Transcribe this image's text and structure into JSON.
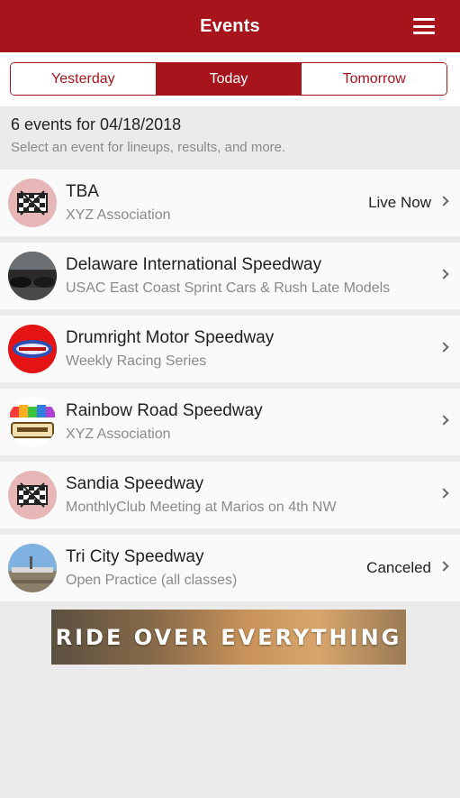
{
  "header": {
    "title": "Events"
  },
  "tabs": [
    {
      "label": "Yesterday",
      "active": false
    },
    {
      "label": "Today",
      "active": true
    },
    {
      "label": "Tomorrow",
      "active": false
    }
  ],
  "summary": {
    "count_text": "6 events for 04/18/2018",
    "hint": "Select an event for lineups, results, and more."
  },
  "events": [
    {
      "name": "TBA",
      "subtitle": "XYZ Association",
      "status": "Live Now",
      "logo": "checkered-flag-icon"
    },
    {
      "name": "Delaware International Speedway",
      "subtitle": "USAC East Coast Sprint Cars & Rush Late Models",
      "status": "",
      "logo": "race-cars-photo"
    },
    {
      "name": "Drumright Motor Speedway",
      "subtitle": "Weekly Racing Series",
      "status": "",
      "logo": "drumright-logo"
    },
    {
      "name": "Rainbow Road Speedway",
      "subtitle": "XYZ Association",
      "status": "",
      "logo": "rainbow-road-logo"
    },
    {
      "name": "Sandia Speedway",
      "subtitle": "MonthlyClub Meeting at Marios on 4th NW",
      "status": "",
      "logo": "checkered-flag-icon"
    },
    {
      "name": "Tri City Speedway",
      "subtitle": "Open Practice (all classes)",
      "status": "Canceled",
      "logo": "speedway-photo"
    }
  ],
  "banner": {
    "text": "RIDE OVER EVERYTHING"
  },
  "colors": {
    "brand": "#a8141b",
    "background": "#ebebeb",
    "row": "#fafafa"
  }
}
